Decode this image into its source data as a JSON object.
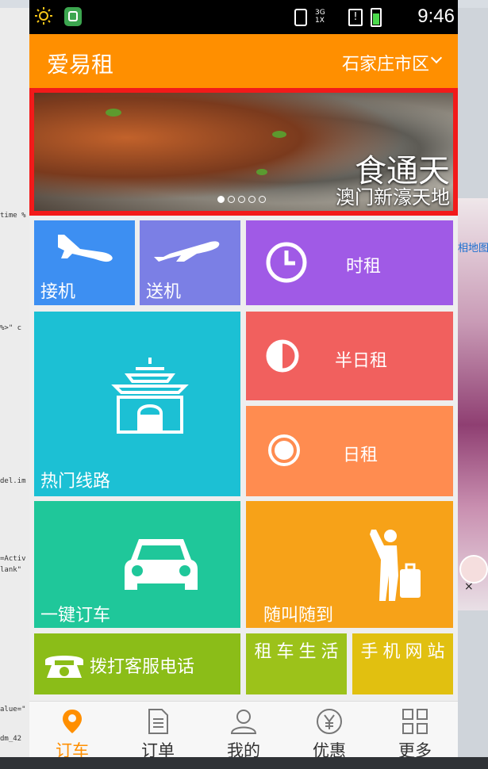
{
  "desktop": {
    "left_lines": [
      "time %",
      "%>\" c",
      "del.im",
      "=Activ",
      "lank\"",
      "alue=\"",
      "dm_42"
    ],
    "right_link": "相地图",
    "right_close": "×"
  },
  "statusbar": {
    "net_label": "3G",
    "net_sub": "1X",
    "sim_label": "!",
    "time": "9:46"
  },
  "appbar": {
    "title": "爱易租",
    "city": "石家庄市区"
  },
  "banner": {
    "title": "食通天",
    "subtitle": "澳门新濠天地",
    "slides": 5,
    "active_slide": 1
  },
  "tiles": {
    "pickup": "接机",
    "send": "送机",
    "hourly": "时租",
    "half_day": "半日租",
    "daily": "日租",
    "route": "热门线路",
    "book": "一键订车",
    "call": "随叫随到",
    "phone": "拨打客服电话",
    "life": "租车生活",
    "web": "手机网站"
  },
  "tabbar": {
    "items": [
      {
        "label": "订车",
        "icon": "location-pin-icon",
        "active": true
      },
      {
        "label": "订单",
        "icon": "document-icon",
        "active": false
      },
      {
        "label": "我的",
        "icon": "user-icon",
        "active": false
      },
      {
        "label": "优惠",
        "icon": "yen-coin-icon",
        "active": false
      },
      {
        "label": "更多",
        "icon": "grid-icon",
        "active": false
      }
    ]
  },
  "colors": {
    "accent": "#ff8f00",
    "banner_border": "#f21a1a"
  }
}
